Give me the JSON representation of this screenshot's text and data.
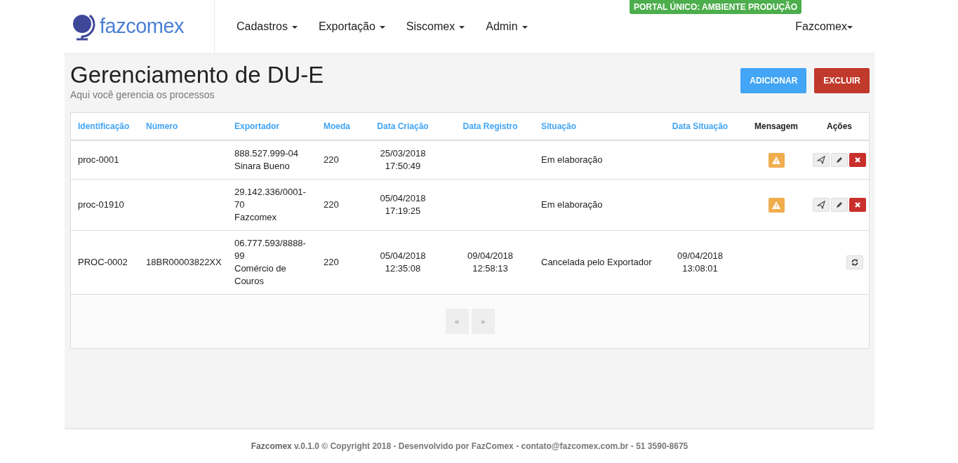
{
  "brand": {
    "name": "fazcomex"
  },
  "badge": "PORTAL ÚNICO: AMBIENTE PRODUÇÃO",
  "menu": [
    {
      "label": "Cadastros"
    },
    {
      "label": "Exportação"
    },
    {
      "label": "Siscomex"
    },
    {
      "label": "Admin"
    }
  ],
  "user_menu": {
    "label": "Fazcomex"
  },
  "page": {
    "title": "Gerenciamento de DU-E",
    "subtitle": "Aqui você gerencia os processos"
  },
  "buttons": [
    {
      "label": "ADICIONAR",
      "kind": "primary"
    },
    {
      "label": "EXCLUIR",
      "kind": "danger"
    }
  ],
  "table": {
    "columns": [
      {
        "label": "Identificação",
        "sortable": true
      },
      {
        "label": "Número",
        "sortable": true
      },
      {
        "label": "Exportador",
        "sortable": true
      },
      {
        "label": "Moeda",
        "sortable": true
      },
      {
        "label": "Data Criação",
        "sortable": true
      },
      {
        "label": "Data Registro",
        "sortable": true
      },
      {
        "label": "Situação",
        "sortable": true
      },
      {
        "label": "Data Situação",
        "sortable": true
      },
      {
        "label": "Mensagem",
        "sortable": false
      },
      {
        "label": "Ações",
        "sortable": false
      }
    ],
    "rows": [
      {
        "id": "proc-0001",
        "numero": "",
        "exportador": [
          "888.527.999-04",
          "Sinara Bueno"
        ],
        "moeda": "220",
        "data_criacao": [
          "25/03/2018",
          "17:50:49"
        ],
        "data_registro": [],
        "situacao": "Em elaboração",
        "data_situacao": [],
        "warning": true,
        "actions": [
          {
            "kind": "send"
          },
          {
            "kind": "edit"
          },
          {
            "kind": "delete"
          }
        ]
      },
      {
        "id": "proc-01910",
        "numero": "",
        "exportador": [
          "29.142.336/0001-70",
          "Fazcomex"
        ],
        "moeda": "220",
        "data_criacao": [
          "05/04/2018",
          "17:19:25"
        ],
        "data_registro": [],
        "situacao": "Em elaboração",
        "data_situacao": [],
        "warning": true,
        "actions": [
          {
            "kind": "send"
          },
          {
            "kind": "edit"
          },
          {
            "kind": "delete"
          }
        ]
      },
      {
        "id": "PROC-0002",
        "numero": "18BR00003822XX",
        "exportador": [
          "06.777.593/8888-99",
          "Comércio de Couros"
        ],
        "moeda": "220",
        "data_criacao": [
          "05/04/2018",
          "12:35:08"
        ],
        "data_registro": [
          "09/04/2018",
          "12:58:13"
        ],
        "situacao": "Cancelada pelo Exportador",
        "data_situacao": [
          "09/04/2018",
          "13:08:01"
        ],
        "warning": false,
        "actions": [
          {
            "kind": "refresh"
          }
        ]
      }
    ]
  },
  "pagination": [
    {
      "label": "«"
    },
    {
      "label": "»"
    }
  ],
  "footer": "**Fazcomex** v.0.1.0 © Copyright 2018 - Desenvolvido por FazComex - contato@fazcomex.com.br - 51 3590-8675"
}
